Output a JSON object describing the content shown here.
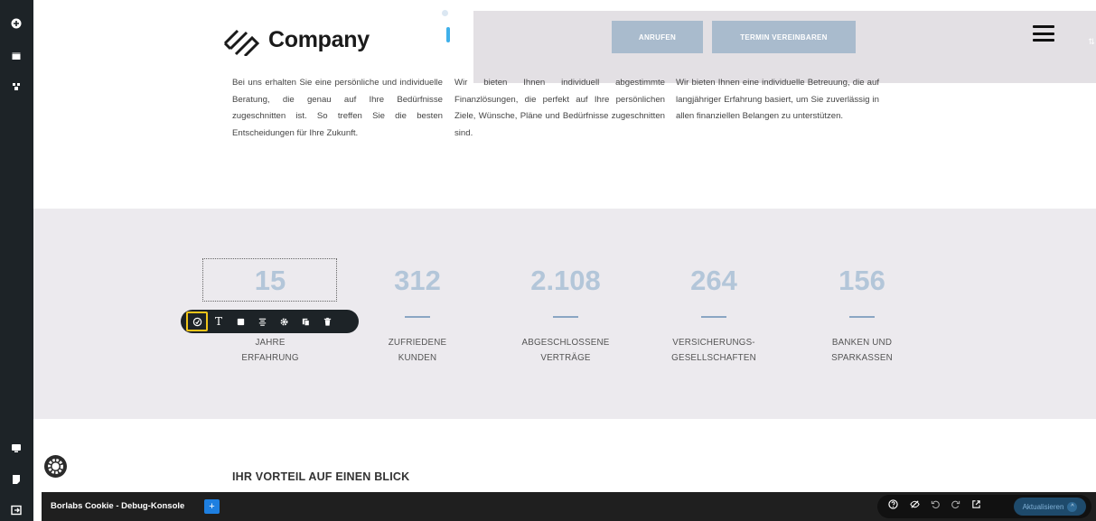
{
  "header": {
    "logo_text": "Company",
    "call_button": "ANRUFEN",
    "appointment_button": "TERMIN VEREINBAREN"
  },
  "intro": {
    "col1": "Bei uns erhalten Sie eine persönliche und individuelle Beratung, die genau auf Ihre Bedürfnisse zugeschnitten ist. So treffen Sie die besten Entscheidungen für Ihre Zukunft.",
    "col2": "Wir bieten Ihnen individuell abgestimmte Finanzlösungen, die perfekt auf Ihre persönlichen Ziele, Wünsche, Pläne und Bedürfnisse zugeschnitten sind.",
    "col3": "Wir bieten Ihnen eine individuelle Betreuung, die auf langjähriger Erfahrung basiert, um Sie zuverlässig in allen finanziellen Belangen zu unterstützen."
  },
  "stats": [
    {
      "number": "15",
      "label_line1": "JAHRE",
      "label_line2": "ERFAHRUNG"
    },
    {
      "number": "312",
      "label_line1": "ZUFRIEDENE",
      "label_line2": "KUNDEN"
    },
    {
      "number": "2.108",
      "label_line1": "ABGESCHLOSSENE",
      "label_line2": "VERTRÄGE"
    },
    {
      "number": "264",
      "label_line1": "VERSICHERUNGS-",
      "label_line2": "GESELLSCHAFTEN"
    },
    {
      "number": "156",
      "label_line1": "BANKEN UND",
      "label_line2": "SPARKASSEN"
    }
  ],
  "toolbar": {
    "icons": [
      "style-icon",
      "text-icon",
      "background-icon",
      "align-icon",
      "settings-icon",
      "duplicate-icon",
      "delete-icon"
    ],
    "text_glyph": "T"
  },
  "section": {
    "title": "IHR VORTEIL AUF EINEN BLICK"
  },
  "console": {
    "title": "Borlabs Cookie - Debug-Konsole",
    "plus": "+",
    "update_label": "Aktualisieren"
  },
  "colors": {
    "accent_blue": "#3fb0ea",
    "header_button": "#a9bbcd",
    "stat_number": "#b3c6d9",
    "stats_bg": "#eceaee",
    "sidebar_bg": "#1d2327",
    "toolbar_highlight": "#f0c419"
  }
}
